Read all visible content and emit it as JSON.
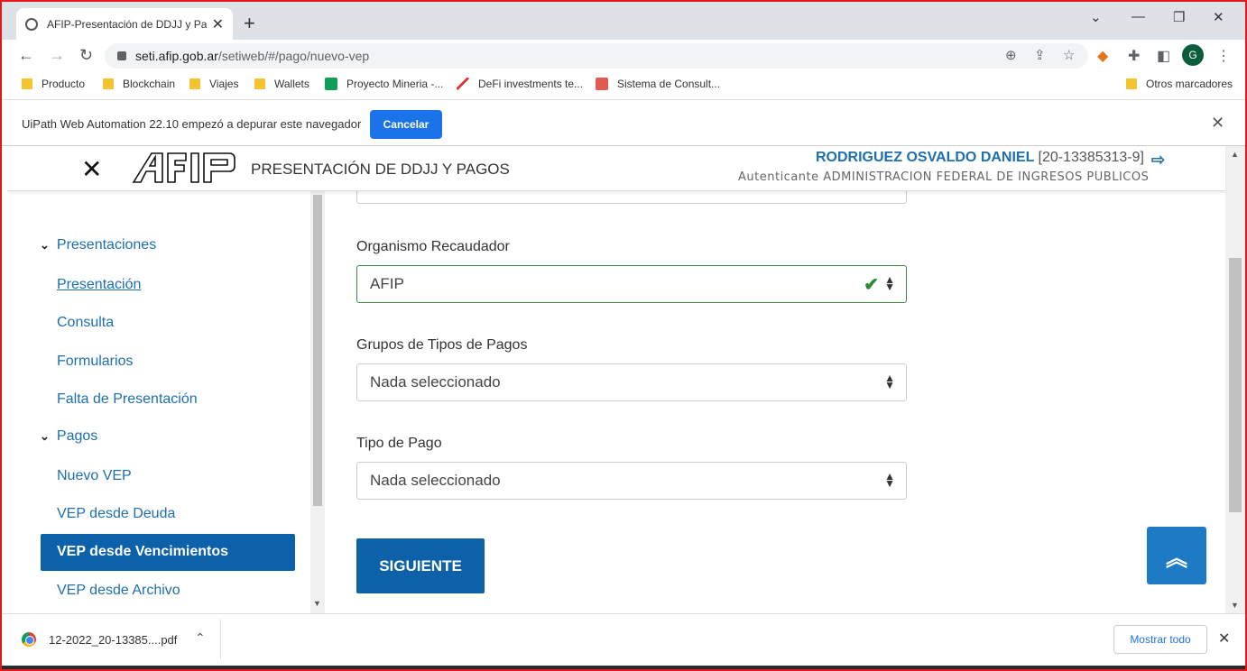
{
  "browser": {
    "tab_title": "AFIP-Presentación de DDJJ y Pag",
    "url_domain": "seti.afip.gob.ar",
    "url_path": "/setiweb/#/pago/nuevo-vep",
    "profile_initial": "G"
  },
  "bookmarks": [
    {
      "label": "Producto",
      "icon": "folder-icon"
    },
    {
      "label": "Blockchain",
      "icon": "folder-icon"
    },
    {
      "label": "Viajes",
      "icon": "folder-icon"
    },
    {
      "label": "Wallets",
      "icon": "folder-icon"
    },
    {
      "label": "Proyecto Mineria -...",
      "icon": "sheets-icon"
    },
    {
      "label": "DeFi investments te...",
      "icon": "chart-icon"
    },
    {
      "label": "Sistema de Consult...",
      "icon": "search-icon"
    }
  ],
  "bookmarks_other": "Otros marcadores",
  "infobar": {
    "message": "UiPath Web Automation 22.10 empezó a depurar este navegador",
    "cancel_label": "Cancelar"
  },
  "header": {
    "title": "PRESENTACIÓN DE DDJJ Y PAGOS",
    "user_name": "RODRIGUEZ OSVALDO DANIEL",
    "user_cuit": "[20-13385313-9]",
    "user_sub": "Autenticante ADMINISTRACION FEDERAL DE INGRESOS PUBLICOS",
    "logo_text": "AFIP"
  },
  "sidebar": {
    "groups": [
      {
        "label": "Presentaciones"
      },
      {
        "label": "Pagos"
      }
    ],
    "items": [
      {
        "label": "Presentación"
      },
      {
        "label": "Consulta"
      },
      {
        "label": "Formularios"
      },
      {
        "label": "Falta de Presentación"
      },
      {
        "label": "Nuevo VEP"
      },
      {
        "label": "VEP desde Deuda"
      },
      {
        "label": "VEP desde Vencimientos"
      },
      {
        "label": "VEP desde Archivo"
      }
    ]
  },
  "form": {
    "organismo_label": "Organismo Recaudador",
    "organismo_value": "AFIP",
    "grupos_label": "Grupos de Tipos de Pagos",
    "grupos_value": "Nada seleccionado",
    "tipo_label": "Tipo de Pago",
    "tipo_value": "Nada seleccionado",
    "next_label": "SIGUIENTE"
  },
  "downloads": {
    "file_name": "12-2022_20-13385....pdf",
    "show_all_label": "Mostrar todo"
  },
  "colors": {
    "afip_blue": "#0c61a8",
    "link_blue": "#1d6fb0",
    "valid_green": "#2e8b34",
    "chrome_blue": "#1a73e8"
  }
}
